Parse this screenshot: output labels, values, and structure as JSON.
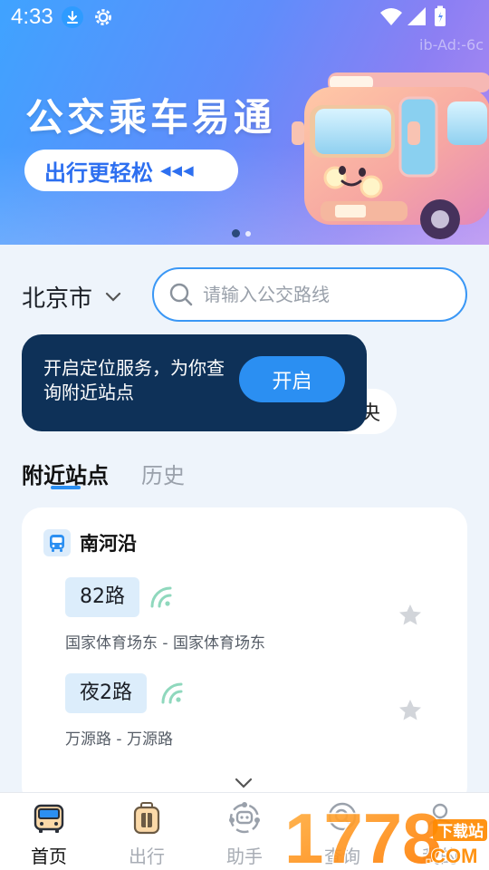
{
  "status_bar": {
    "time": "4:33",
    "device_id": "ib-Ad:-6c"
  },
  "banner": {
    "title": "公交乘车易通",
    "pill_text": "出行更轻松",
    "pill_arrows": "◀◀◀",
    "page_indicator": {
      "current": 1,
      "total": 2
    }
  },
  "location": {
    "city": "北京市"
  },
  "search": {
    "placeholder": "请输入公交路线",
    "value": ""
  },
  "tooltip": {
    "text": "开启定位服务，为你查询附近站点",
    "button_label": "开启"
  },
  "hidden_chip": {
    "visible_char": "央"
  },
  "tabs": [
    {
      "label": "附近站点",
      "active": true
    },
    {
      "label": "历史",
      "active": false
    }
  ],
  "nearby": {
    "stop_name": "南河沿",
    "routes": [
      {
        "name": "82路",
        "description": "国家体育场东 - 国家体育场东",
        "favorited": false
      },
      {
        "name": "夜2路",
        "description": "万源路 - 万源路",
        "favorited": false
      }
    ]
  },
  "bottom_nav": {
    "items": [
      {
        "label": "首页",
        "icon": "bus-home-icon",
        "active": true
      },
      {
        "label": "出行",
        "icon": "luggage-icon",
        "active": false
      },
      {
        "label": "助手",
        "icon": "assistant-icon",
        "active": false
      },
      {
        "label": "查询",
        "icon": "search-query-icon",
        "active": false
      },
      {
        "label": "我的",
        "icon": "user-icon",
        "active": false
      }
    ]
  },
  "watermark": {
    "text": "1778",
    "suffix": ".COM",
    "tag": "下载站"
  },
  "colors": {
    "accent": "#2b8ff2",
    "tooltip_bg": "#0e3158",
    "route_badge_bg": "#dcedfb",
    "page_bg": "#eef4fb"
  }
}
